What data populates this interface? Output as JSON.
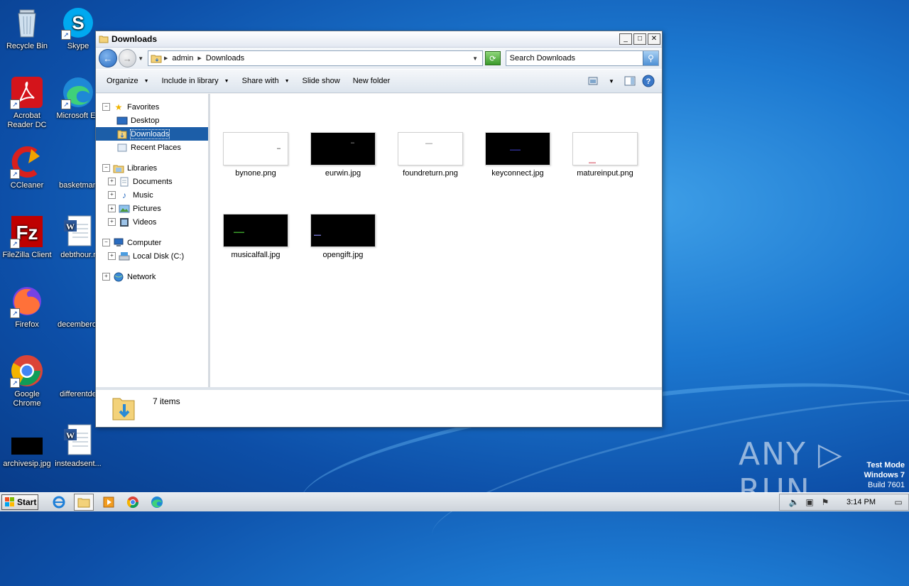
{
  "desktop": {
    "icons": [
      {
        "label": "Recycle Bin"
      },
      {
        "label": "Skype"
      },
      {
        "label": "Acrobat Reader DC"
      },
      {
        "label": "Microsoft Ed"
      },
      {
        "label": "CCleaner"
      },
      {
        "label": "basketman"
      },
      {
        "label": "FileZilla Client"
      },
      {
        "label": "debthour.r"
      },
      {
        "label": "Firefox"
      },
      {
        "label": "decemberot"
      },
      {
        "label": "Google Chrome"
      },
      {
        "label": "differentde"
      },
      {
        "label": "archivesip.jpg"
      },
      {
        "label": "insteadsent..."
      }
    ]
  },
  "window": {
    "title": "Downloads",
    "buttons": {
      "minimize": "_",
      "maximize": "□",
      "close": "✕"
    }
  },
  "navbar": {
    "breadcrumb": [
      "admin",
      "Downloads"
    ],
    "search_placeholder": "Search Downloads"
  },
  "toolbar": {
    "organize": "Organize",
    "include_in_library": "Include in library",
    "share_with": "Share with",
    "slide_show": "Slide show",
    "new_folder": "New folder"
  },
  "navpane": {
    "favorites": "Favorites",
    "desktop": "Desktop",
    "downloads": "Downloads",
    "recent_places": "Recent Places",
    "libraries": "Libraries",
    "documents": "Documents",
    "music": "Music",
    "pictures": "Pictures",
    "videos": "Videos",
    "computer": "Computer",
    "local_disk": "Local Disk (C:)",
    "network": "Network"
  },
  "files": [
    {
      "name": "bynone.png",
      "thumb": "white"
    },
    {
      "name": "eurwin.jpg",
      "thumb": "black"
    },
    {
      "name": "foundreturn.png",
      "thumb": "white"
    },
    {
      "name": "keyconnect.jpg",
      "thumb": "black"
    },
    {
      "name": "matureinput.png",
      "thumb": "white"
    },
    {
      "name": "musicalfall.jpg",
      "thumb": "black"
    },
    {
      "name": "opengift.jpg",
      "thumb": "black"
    }
  ],
  "status": {
    "item_count": "7 items"
  },
  "watermark": {
    "brand": "ANY ▷ RUN",
    "line1": "Test Mode",
    "line2": "Windows 7",
    "line3": "Build 7601"
  },
  "taskbar": {
    "start_label": "Start",
    "clock": "3:14 PM"
  },
  "colors": {
    "selection": "#1c5ea8",
    "desktop": "#1c78d0"
  }
}
